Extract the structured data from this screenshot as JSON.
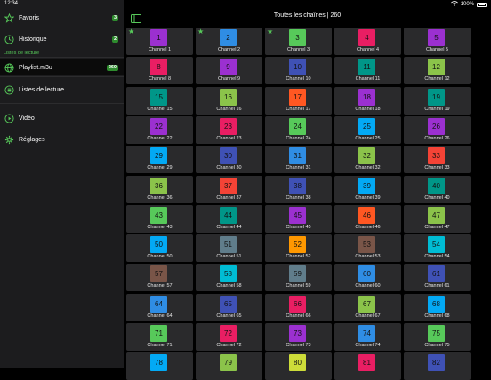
{
  "status": {
    "time": "12:34",
    "battery": "100%"
  },
  "sidebar": {
    "items": [
      {
        "key": "favoris",
        "label": "Favoris",
        "badge": "3",
        "icon": "star-icon"
      },
      {
        "key": "historique",
        "label": "Historique",
        "badge": "2",
        "icon": "clock-icon"
      }
    ],
    "section_label": "Listes de lecture",
    "playlists": [
      {
        "key": "playlist",
        "label": "Playlist.m3u",
        "badge": "260",
        "icon": "globe-icon",
        "selected": true
      },
      {
        "key": "listes",
        "label": "Listes de lecture",
        "icon": "list-icon"
      }
    ],
    "bottom": [
      {
        "key": "video",
        "label": "Vidéo",
        "icon": "video-icon"
      },
      {
        "key": "reglages",
        "label": "Réglages",
        "icon": "gear-icon"
      }
    ]
  },
  "header": {
    "title": "Toutes les chaînes | 260"
  },
  "channels": [
    {
      "n": "1",
      "name": "Channel 1",
      "color": "#9b30d0",
      "fav": true
    },
    {
      "n": "2",
      "name": "Channel 2",
      "color": "#2f8de4",
      "fav": true
    },
    {
      "n": "3",
      "name": "Channel 3",
      "color": "#57c95a",
      "fav": true
    },
    {
      "n": "4",
      "name": "Channel 4",
      "color": "#e91e63"
    },
    {
      "n": "5",
      "name": "Channel 5",
      "color": "#9b30d0"
    },
    {
      "n": "8",
      "name": "Channel 8",
      "color": "#e91e63"
    },
    {
      "n": "9",
      "name": "Channel 9",
      "color": "#9b30d0"
    },
    {
      "n": "10",
      "name": "Channel 10",
      "color": "#3f51b5"
    },
    {
      "n": "11",
      "name": "Channel 11",
      "color": "#009688"
    },
    {
      "n": "12",
      "name": "Channel 12",
      "color": "#8bc34a"
    },
    {
      "n": "15",
      "name": "Channel 15",
      "color": "#009688"
    },
    {
      "n": "16",
      "name": "Channel 16",
      "color": "#8bc34a"
    },
    {
      "n": "17",
      "name": "Channel 17",
      "color": "#ff5722"
    },
    {
      "n": "18",
      "name": "Channel 18",
      "color": "#9b30d0"
    },
    {
      "n": "19",
      "name": "Channel 19",
      "color": "#009688"
    },
    {
      "n": "22",
      "name": "Channel 22",
      "color": "#9b30d0"
    },
    {
      "n": "23",
      "name": "Channel 23",
      "color": "#e91e63"
    },
    {
      "n": "24",
      "name": "Channel 24",
      "color": "#57c95a"
    },
    {
      "n": "25",
      "name": "Channel 25",
      "color": "#03a9f4"
    },
    {
      "n": "26",
      "name": "Channel 26",
      "color": "#9b30d0"
    },
    {
      "n": "29",
      "name": "Channel 29",
      "color": "#03a9f4"
    },
    {
      "n": "30",
      "name": "Channel 30",
      "color": "#3f51b5"
    },
    {
      "n": "31",
      "name": "Channel 31",
      "color": "#2f8de4"
    },
    {
      "n": "32",
      "name": "Channel 32",
      "color": "#8bc34a"
    },
    {
      "n": "33",
      "name": "Channel 33",
      "color": "#f44336"
    },
    {
      "n": "36",
      "name": "Channel 36",
      "color": "#8bc34a"
    },
    {
      "n": "37",
      "name": "Channel 37",
      "color": "#f44336"
    },
    {
      "n": "38",
      "name": "Channel 38",
      "color": "#3f51b5"
    },
    {
      "n": "39",
      "name": "Channel 39",
      "color": "#03a9f4"
    },
    {
      "n": "40",
      "name": "Channel 40",
      "color": "#009688"
    },
    {
      "n": "43",
      "name": "Channel 43",
      "color": "#57c95a"
    },
    {
      "n": "44",
      "name": "Channel 44",
      "color": "#009688"
    },
    {
      "n": "45",
      "name": "Channel 45",
      "color": "#9b30d0"
    },
    {
      "n": "46",
      "name": "Channel 46",
      "color": "#ff5722"
    },
    {
      "n": "47",
      "name": "Channel 47",
      "color": "#8bc34a"
    },
    {
      "n": "50",
      "name": "Channel 50",
      "color": "#03a9f4"
    },
    {
      "n": "51",
      "name": "Channel 51",
      "color": "#607d8b"
    },
    {
      "n": "52",
      "name": "Channel 52",
      "color": "#ff9800"
    },
    {
      "n": "53",
      "name": "Channel 53",
      "color": "#795548"
    },
    {
      "n": "54",
      "name": "Channel 54",
      "color": "#00bcd4"
    },
    {
      "n": "57",
      "name": "Channel 57",
      "color": "#795548"
    },
    {
      "n": "58",
      "name": "Channel 58",
      "color": "#00bcd4"
    },
    {
      "n": "59",
      "name": "Channel 59",
      "color": "#607d8b"
    },
    {
      "n": "60",
      "name": "Channel 60",
      "color": "#2f8de4"
    },
    {
      "n": "61",
      "name": "Channel 61",
      "color": "#3f51b5"
    },
    {
      "n": "64",
      "name": "Channel 64",
      "color": "#2f8de4"
    },
    {
      "n": "65",
      "name": "Channel 65",
      "color": "#3f51b5"
    },
    {
      "n": "66",
      "name": "Channel 66",
      "color": "#e91e63"
    },
    {
      "n": "67",
      "name": "Channel 67",
      "color": "#8bc34a"
    },
    {
      "n": "68",
      "name": "Channel 68",
      "color": "#03a9f4"
    },
    {
      "n": "71",
      "name": "Channel 71",
      "color": "#57c95a"
    },
    {
      "n": "72",
      "name": "Channel 72",
      "color": "#e91e63"
    },
    {
      "n": "73",
      "name": "Channel 73",
      "color": "#9b30d0"
    },
    {
      "n": "74",
      "name": "Channel 74",
      "color": "#2f8de4"
    },
    {
      "n": "75",
      "name": "Channel 75",
      "color": "#57c95a"
    },
    {
      "n": "78",
      "name": "",
      "color": "#03a9f4"
    },
    {
      "n": "79",
      "name": "",
      "color": "#8bc34a"
    },
    {
      "n": "80",
      "name": "",
      "color": "#cddc39"
    },
    {
      "n": "81",
      "name": "",
      "color": "#e91e63"
    },
    {
      "n": "82",
      "name": "",
      "color": "#3f51b5"
    }
  ]
}
